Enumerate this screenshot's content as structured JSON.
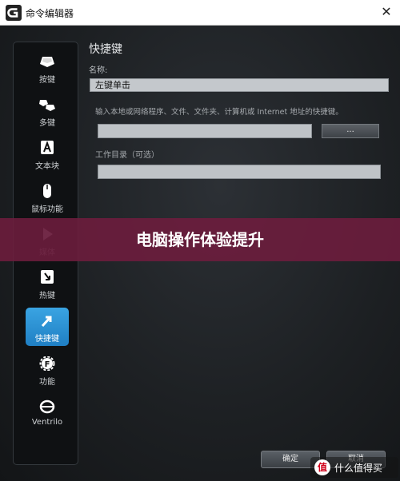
{
  "window": {
    "title": "命令编辑器",
    "close_glyph": "✕",
    "logo_icon": "logitech-g-icon"
  },
  "sidebar": {
    "items": [
      {
        "label": "按键",
        "icon": "keycap-icon"
      },
      {
        "label": "多键",
        "icon": "multikey-icon"
      },
      {
        "label": "文本块",
        "icon": "text-block-icon"
      },
      {
        "label": "鼠标功能",
        "icon": "mouse-icon"
      },
      {
        "label": "媒体",
        "icon": "play-icon"
      },
      {
        "label": "热键",
        "icon": "hotkey-icon"
      },
      {
        "label": "快捷键",
        "icon": "shortcut-arrow-icon",
        "active": true
      },
      {
        "label": "功能",
        "icon": "function-gear-icon"
      },
      {
        "label": "Ventrilo",
        "icon": "ventrilo-icon"
      }
    ]
  },
  "form": {
    "section_title": "快捷键",
    "name_label": "名称:",
    "name_value": "左键单击",
    "hint": "输入本地或网络程序、文件、文件夹、计算机或 Internet 地址的快捷键。",
    "path_value": "",
    "browse_label": "...",
    "workdir_label": "工作目录（可选）",
    "workdir_value": ""
  },
  "banner": {
    "text": "电脑操作体验提升"
  },
  "buttons": {
    "ok": "确定",
    "cancel": "取消"
  },
  "watermark": {
    "logo": "值",
    "text": "什么值得买"
  },
  "colors": {
    "accent": "#2a92d6",
    "banner": "#6e1c3e",
    "background": "#1d2023"
  }
}
